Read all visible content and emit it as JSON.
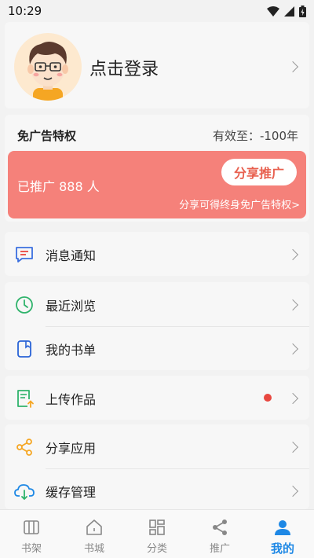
{
  "status_bar": {
    "time": "10:29"
  },
  "profile": {
    "login_label": "点击登录"
  },
  "vip": {
    "title": "免广告特权",
    "expire": "有效至：-100年",
    "promo_count": "已推广 888 人",
    "share_button": "分享推广",
    "share_hint": "分享可得终身免广告特权>"
  },
  "menu": {
    "messages": "消息通知",
    "recent": "最近浏览",
    "booklist": "我的书单",
    "upload": "上传作品",
    "share_app": "分享应用",
    "cache": "缓存管理"
  },
  "tabs": [
    {
      "label": "书架",
      "icon": "bookshelf-icon"
    },
    {
      "label": "书城",
      "icon": "home-icon"
    },
    {
      "label": "分类",
      "icon": "category-icon"
    },
    {
      "label": "推广",
      "icon": "share-icon"
    },
    {
      "label": "我的",
      "icon": "user-icon",
      "active": true
    }
  ],
  "colors": {
    "accent": "#1e88e5",
    "banner": "#f5817a",
    "share_button_text": "#e8604f",
    "dot": "#e8473f"
  }
}
